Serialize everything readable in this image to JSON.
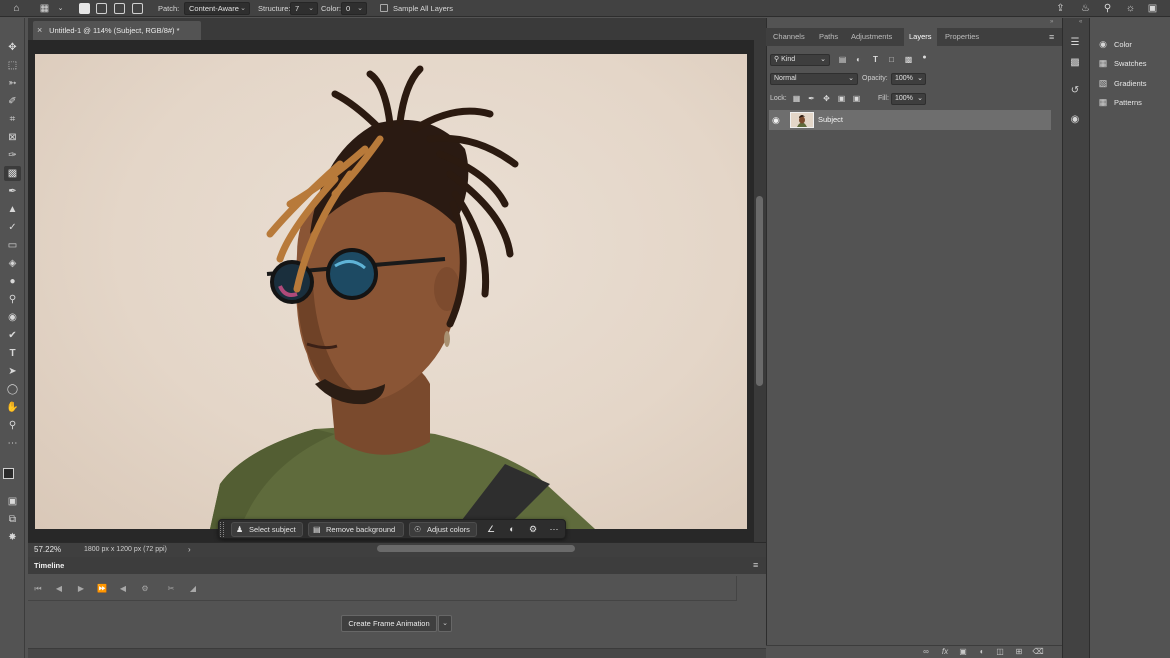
{
  "options_bar": {
    "patch_label": "Patch:",
    "patch_value": "Content-Aware",
    "structure_label": "Structure:",
    "structure_value": "7",
    "color_label": "Color:",
    "color_value": "0",
    "sample_all_layers": "Sample All Layers"
  },
  "document": {
    "tab_title": "Untitled-1 @ 114% (Subject, RGB/8#) *",
    "zoom": "57.22%",
    "info": "1800 px x 1200 px (72 ppi)"
  },
  "context_bar": {
    "select_subject": "Select subject",
    "remove_background": "Remove background",
    "adjust_colors": "Adjust colors"
  },
  "timeline": {
    "title": "Timeline",
    "create_frame_animation": "Create Frame Animation"
  },
  "layers_panel": {
    "tabs": [
      "Channels",
      "Paths",
      "Adjustments",
      "Layers",
      "Properties"
    ],
    "active_tab": "Layers",
    "filter_kind": "Kind",
    "blend_mode": "Normal",
    "opacity_label": "Opacity:",
    "opacity_value": "100%",
    "lock_label": "Lock:",
    "fill_label": "Fill:",
    "fill_value": "100%",
    "layers": [
      {
        "name": "Subject",
        "visible": true
      }
    ]
  },
  "right_panels": {
    "items": [
      "Color",
      "Swatches",
      "Gradients",
      "Patterns"
    ]
  },
  "icons": {
    "accent_layer_selected": "#6e6e6e",
    "background_color": "#535353"
  }
}
